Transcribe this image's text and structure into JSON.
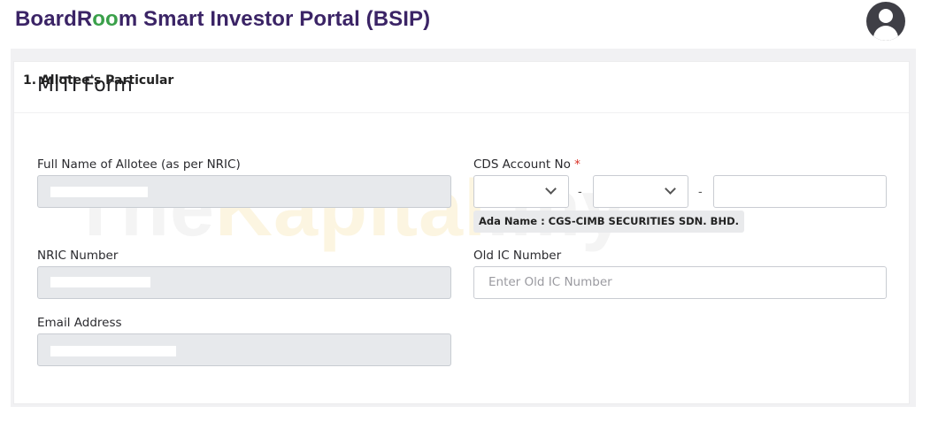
{
  "header": {
    "brand_part1": "BoardR",
    "brand_oo": "oo",
    "brand_part2": "m Smart Investor Portal (BSIP)",
    "avatar_icon": "user-avatar-icon"
  },
  "form": {
    "title": "MITI Form",
    "section_title": "1. Allotee's Particular",
    "full_name_label": "Full Name of Allotee (as per NRIC)",
    "cds_label": "CDS Account No",
    "required_mark": "*",
    "cds_separator": "-",
    "ada_name": "Ada Name : CGS-CIMB SECURITIES SDN. BHD.",
    "nric_label": "NRIC Number",
    "old_ic_label": "Old IC Number",
    "old_ic_placeholder": "Enter Old IC Number",
    "email_label": "Email Address"
  },
  "watermark": {
    "part1": "The",
    "part2": "Kapital",
    "part3": ".my"
  },
  "colors": {
    "brand": "#3b2466",
    "brand_accent": "#3aa04a",
    "required": "#d93025",
    "disabled_field": "#e7e9ec"
  }
}
